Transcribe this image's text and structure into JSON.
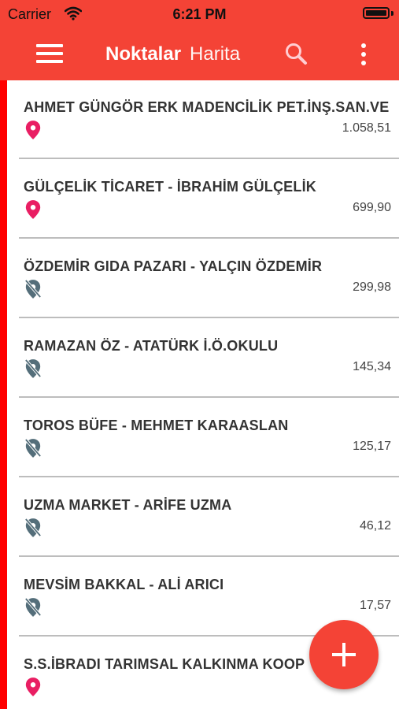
{
  "status_bar": {
    "carrier": "Carrier",
    "time": "6:21 PM"
  },
  "app_bar": {
    "tabs": [
      {
        "label": "Noktalar",
        "active": true
      },
      {
        "label": "Harita",
        "active": false
      }
    ],
    "icons": [
      "menu-icon",
      "search-icon",
      "more-vert-icon"
    ],
    "color": "#f44336"
  },
  "list": [
    {
      "name": "AHMET GÜNGÖR ERK MADENCİLİK PET.İNŞ.SAN.VE",
      "amount": "1.058,51",
      "location": "located",
      "pin_color": "#e91e63"
    },
    {
      "name": "GÜLÇELİK TİCARET - İBRAHİM GÜLÇELİK",
      "amount": "699,90",
      "location": "located",
      "pin_color": "#e91e63"
    },
    {
      "name": "ÖZDEMİR GIDA PAZARI - YALÇIN ÖZDEMİR",
      "amount": "299,98",
      "location": "not-located",
      "pin_color": "#546e7a"
    },
    {
      "name": "RAMAZAN ÖZ - ATATÜRK İ.Ö.OKULU",
      "amount": "145,34",
      "location": "not-located",
      "pin_color": "#546e7a"
    },
    {
      "name": "TOROS BÜFE - MEHMET KARAASLAN",
      "amount": "125,17",
      "location": "not-located",
      "pin_color": "#546e7a"
    },
    {
      "name": "UZMA MARKET - ARİFE UZMA",
      "amount": "46,12",
      "location": "not-located",
      "pin_color": "#546e7a"
    },
    {
      "name": "MEVSİM BAKKAL - ALİ ARICI",
      "amount": "17,57",
      "location": "not-located",
      "pin_color": "#546e7a"
    },
    {
      "name": "S.S.İBRADI TARIMSAL KALKINMA KOOP",
      "amount": "",
      "location": "located",
      "pin_color": "#e91e63"
    }
  ],
  "fab": {
    "icon": "add-icon"
  }
}
